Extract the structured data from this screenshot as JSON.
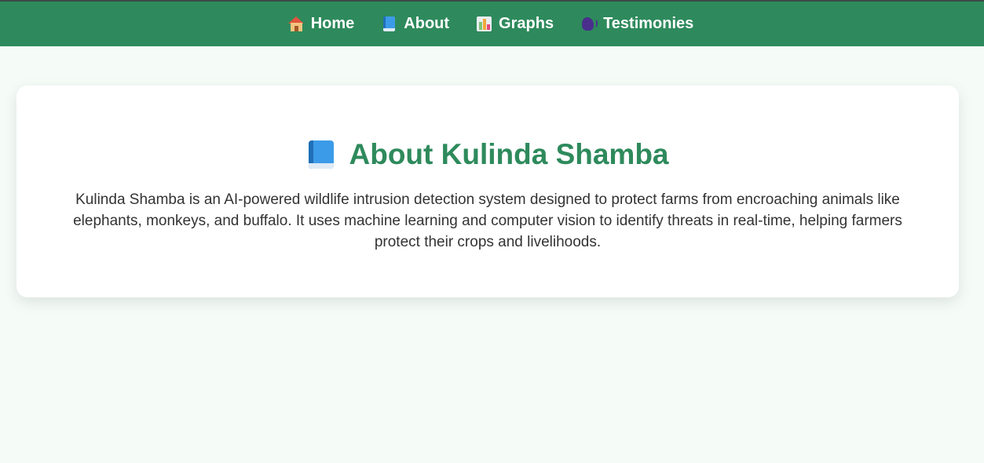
{
  "nav": {
    "items": [
      {
        "label": "Home",
        "icon": "house-icon"
      },
      {
        "label": "About",
        "icon": "book-icon"
      },
      {
        "label": "Graphs",
        "icon": "bar-chart-icon"
      },
      {
        "label": "Testimonies",
        "icon": "speaking-head-icon"
      }
    ]
  },
  "about": {
    "title": "About Kulinda Shamba",
    "title_icon": "book-icon",
    "description": "Kulinda Shamba is an AI-powered wildlife intrusion detection system designed to protect farms from encroaching animals like elephants, monkeys, and buffalo. It uses machine learning and computer vision to identify threats in real-time, helping farmers protect their crops and livelihoods."
  },
  "colors": {
    "nav_background": "#2e8a5c",
    "page_background": "#f5fcf8",
    "title_color": "#2e8a5c",
    "text_color": "#333333"
  }
}
